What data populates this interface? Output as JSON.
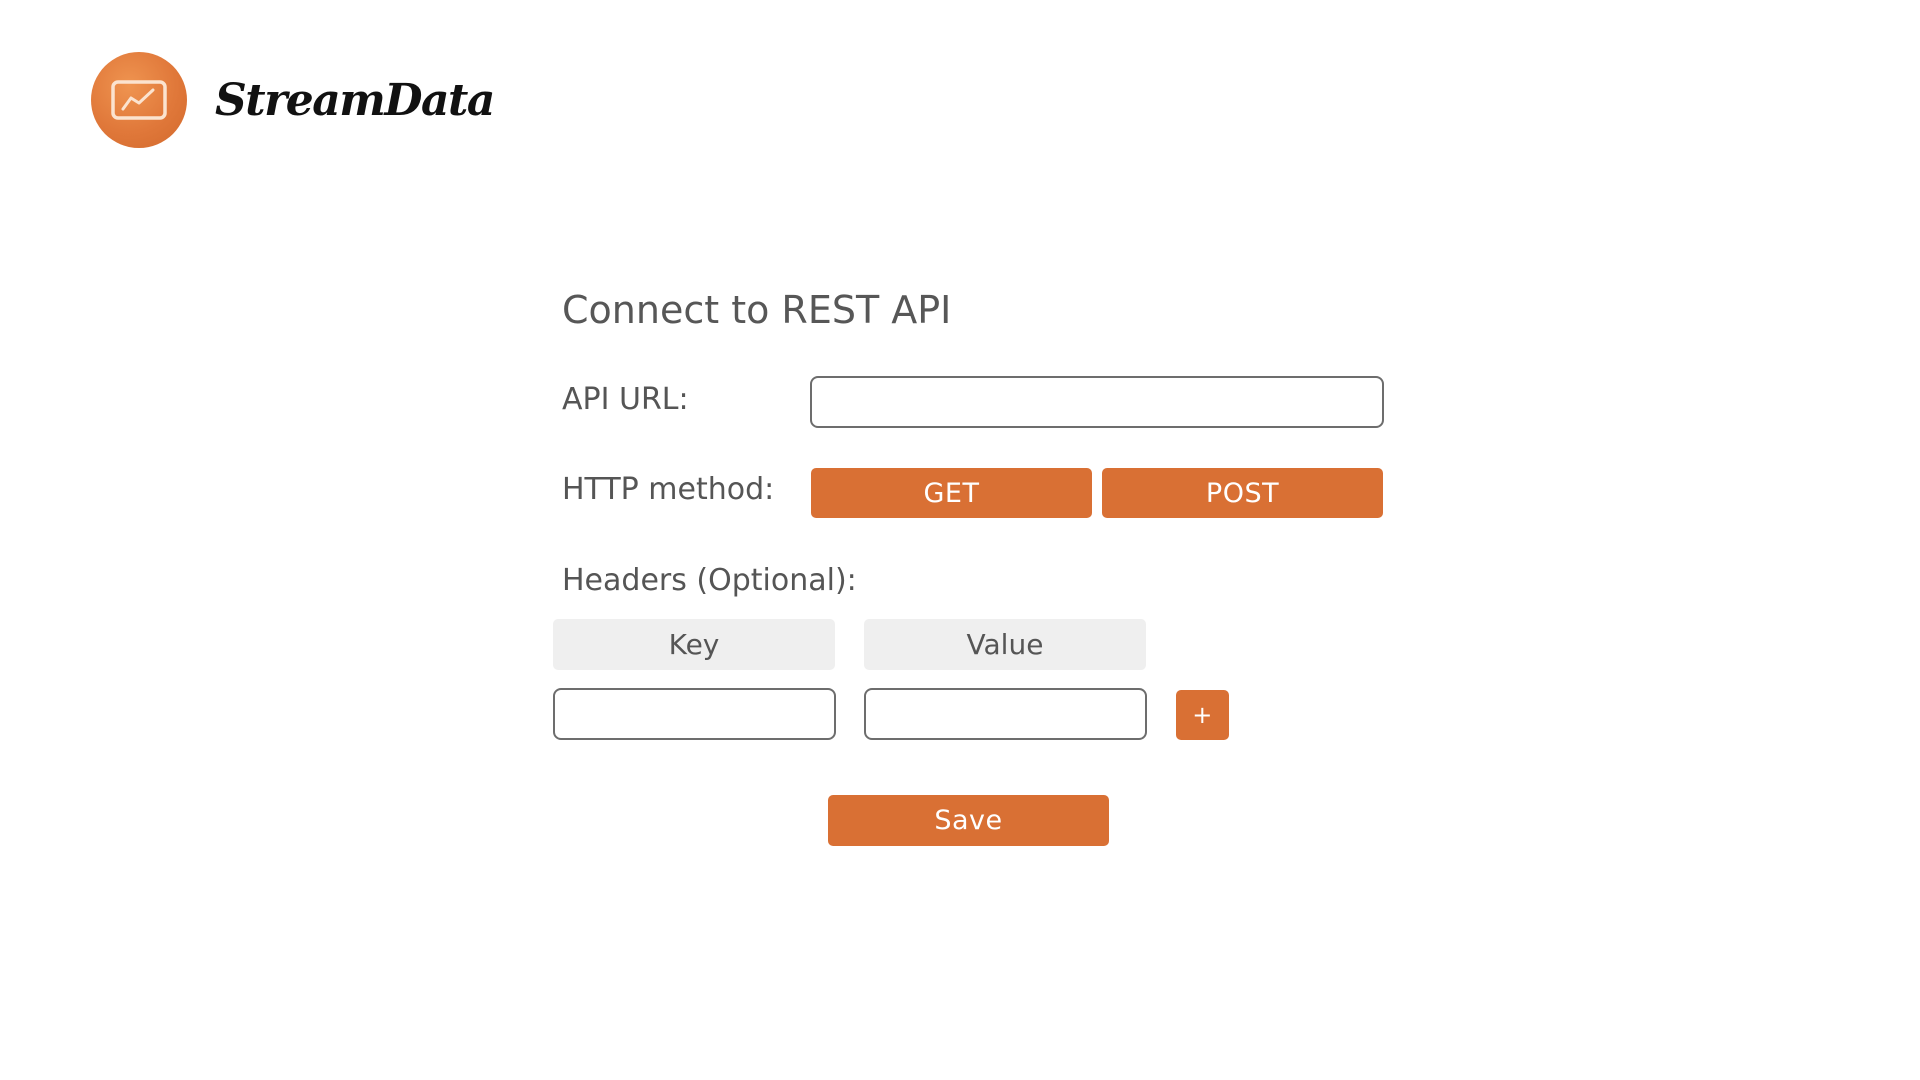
{
  "brand": {
    "name": "StreamData",
    "logo_icon": "chart-line-icon",
    "accent_color": "#d97034"
  },
  "form": {
    "title": "Connect to REST API",
    "api_url": {
      "label": "API URL:",
      "value": "",
      "placeholder": ""
    },
    "http_method": {
      "label": "HTTP method:",
      "options": [
        "GET",
        "POST"
      ]
    },
    "headers": {
      "label": "Headers (Optional):",
      "columns": [
        "Key",
        "Value"
      ],
      "rows": [
        {
          "key": "",
          "value": ""
        }
      ],
      "add_label": "+"
    },
    "save_label": "Save"
  }
}
